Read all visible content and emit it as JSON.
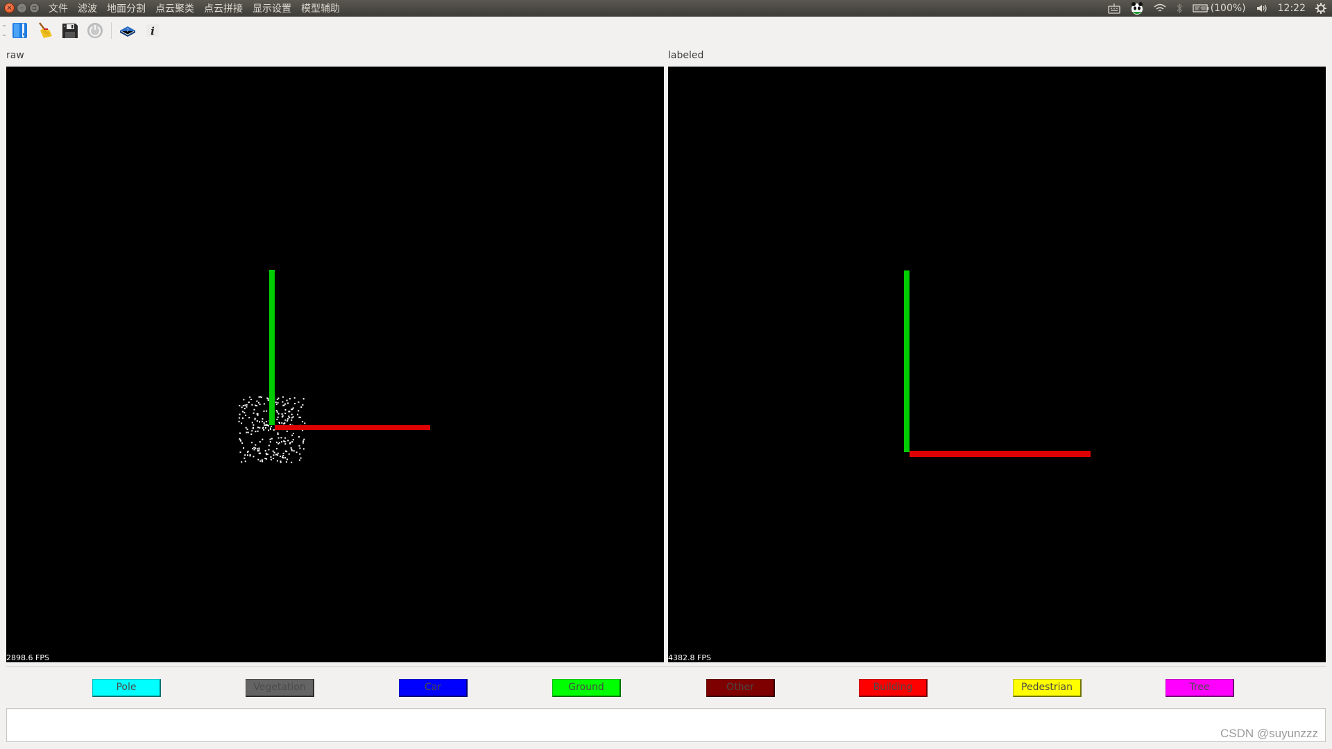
{
  "menubar": {
    "window_controls": [
      "close",
      "minimize",
      "maximize"
    ],
    "items": [
      "文件",
      "滤波",
      "地面分割",
      "点云聚类",
      "点云拼接",
      "显示设置",
      "模型辅助"
    ],
    "tray": {
      "keyboard_icon": "keyboard-icon",
      "app_icon": "panda-icon",
      "wifi_icon": "wifi-icon",
      "bluetooth_icon": "bluetooth-icon",
      "battery": "(100%)",
      "volume_icon": "volume-icon",
      "clock": "12:22",
      "settings_icon": "power-settings-icon"
    }
  },
  "toolbar": {
    "buttons": [
      {
        "name": "open-file",
        "icon": "open-file-icon"
      },
      {
        "name": "clear",
        "icon": "broom-icon"
      },
      {
        "name": "save",
        "icon": "floppy-disk-icon"
      },
      {
        "name": "power",
        "icon": "power-icon"
      },
      {
        "name": "help",
        "icon": "help-book-icon"
      },
      {
        "name": "about",
        "icon": "info-icon"
      }
    ]
  },
  "views": {
    "raw": {
      "label": "raw",
      "fps": "2898.6 FPS"
    },
    "labeled": {
      "label": "labeled",
      "fps": "4382.8 FPS"
    }
  },
  "axis_colors": {
    "x": "#e00000",
    "y": "#00cc00"
  },
  "label_buttons": [
    {
      "label": "Pole",
      "color": "#00ffff"
    },
    {
      "label": "Vegetation",
      "color": "#646464"
    },
    {
      "label": "Car",
      "color": "#0000ff"
    },
    {
      "label": "Ground",
      "color": "#00ff00"
    },
    {
      "label": "Other",
      "color": "#7f0000"
    },
    {
      "label": "Building",
      "color": "#ff0000"
    },
    {
      "label": "Pedestrian",
      "color": "#ffff00"
    },
    {
      "label": "Tree",
      "color": "#ff00ff"
    }
  ],
  "output_log": "",
  "watermark": "CSDN @suyunzzz"
}
